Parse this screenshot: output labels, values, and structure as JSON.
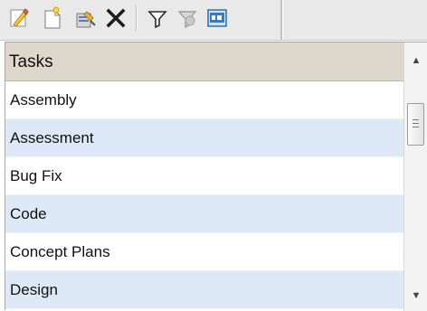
{
  "toolbar": {
    "icons": [
      "edit-icon",
      "new-icon",
      "properties-icon",
      "delete-icon",
      "filter-icon",
      "clear-filter-icon",
      "field-chooser-icon"
    ]
  },
  "grid": {
    "header": "Tasks",
    "rows": [
      "Assembly",
      "Assessment",
      "Bug Fix",
      "Code",
      "Concept Plans",
      "Design"
    ]
  },
  "scrollbar": {
    "up_arrow": "▲",
    "down_arrow": "▼"
  },
  "colors": {
    "header_bg": "#ddd7cc",
    "row_alt_bg": "#dde9f7",
    "toolbar_bg": "#e9e9e9"
  }
}
